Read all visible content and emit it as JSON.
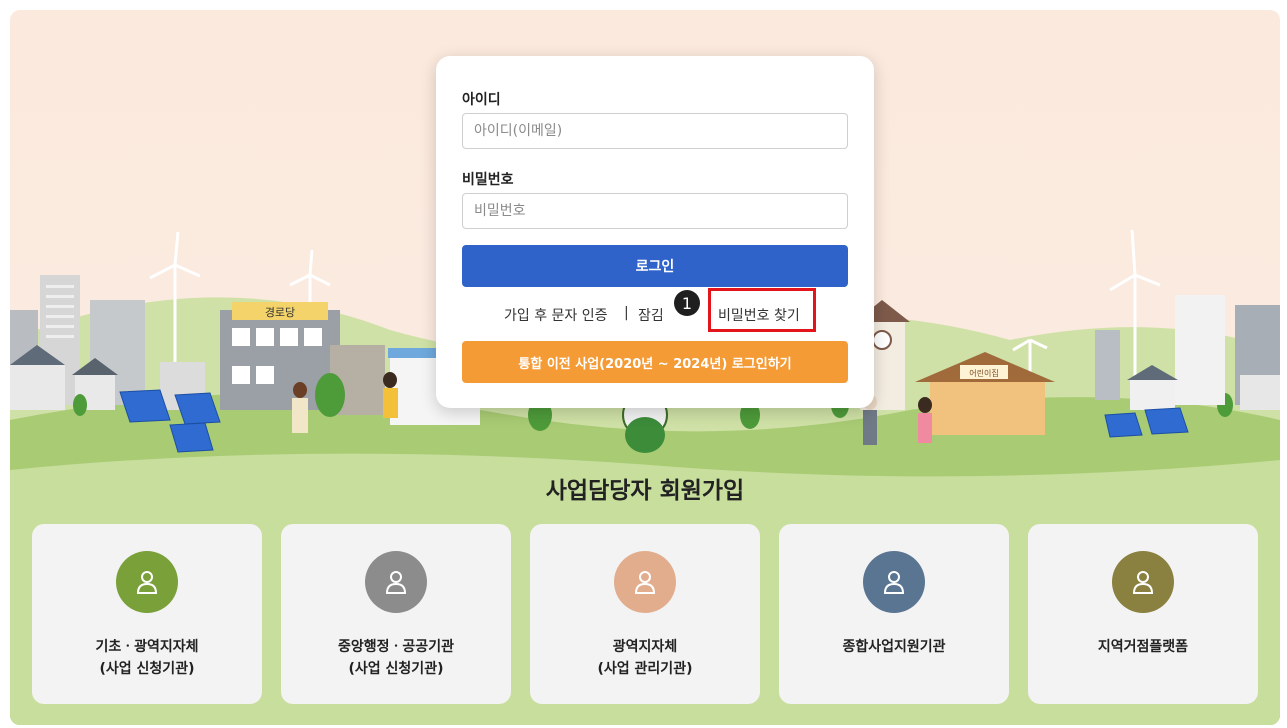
{
  "login": {
    "id_label": "아이디",
    "id_placeholder": "아이디(이메일)",
    "pw_label": "비밀번호",
    "pw_placeholder": "비밀번호",
    "login_button": "로그인",
    "links": {
      "sms_verify": "가입 후 문자 인증",
      "separator": "|",
      "unlock": "잠김",
      "find_password": "비밀번호 찾기"
    },
    "step_badge": "1",
    "legacy_button": "통합 이전 사업(2020년 ~ 2024년) 로그인하기"
  },
  "background": {
    "building_sign_left": "경로당",
    "building_sign_right": "어린이집"
  },
  "signup": {
    "title": "사업담당자 회원가입",
    "cards": [
      {
        "label": "기초ㆍ광역지자체\n(사업 신청기관)",
        "color": "#7aa03a"
      },
      {
        "label": "중앙행정ㆍ공공기관\n(사업 신청기관)",
        "color": "#8c8c8c"
      },
      {
        "label": "광역지자체\n(사업 관리기관)",
        "color": "#e2ad8d"
      },
      {
        "label": "종합사업지원기관",
        "color": "#5a7591"
      },
      {
        "label": "지역거점플랫폼",
        "color": "#8a8040"
      }
    ]
  }
}
